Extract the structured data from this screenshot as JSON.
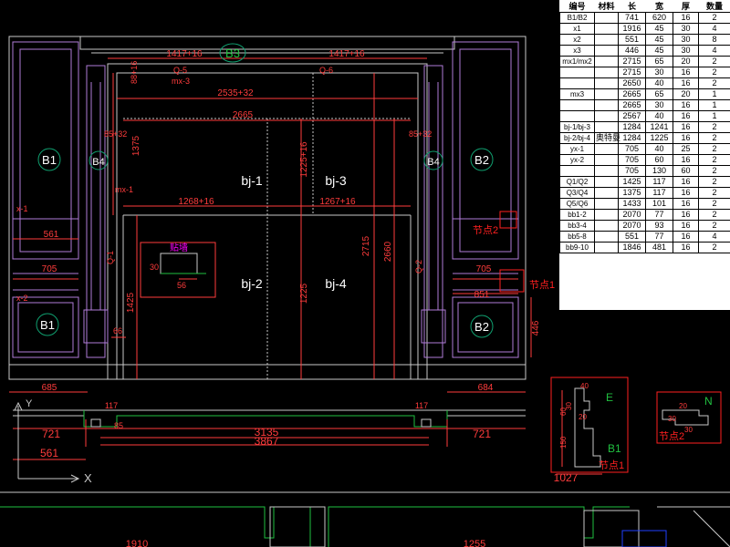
{
  "colors": {
    "background": "#000000",
    "frame": "#c9c9c9",
    "moulding": "#b07cd8",
    "dimension": "#ff3c3c",
    "section": "#20c040",
    "tag_ring": "#10a070",
    "callout": "#ff2020",
    "tag_text": "#ffffff",
    "highlight": "#ff00ff",
    "bom_bg": "#ffffff"
  },
  "elevation": {
    "tags": [
      "B1",
      "B2",
      "B3",
      "B4",
      "B4",
      "B1",
      "B2"
    ],
    "panels": [
      "bj-1",
      "bj-3",
      "bj-2",
      "bj-4"
    ],
    "dims_top": [
      "1417+16",
      "1417+16"
    ],
    "dims_inner": [
      "2535+32",
      "2665",
      "1268+16",
      "1267+16"
    ],
    "dims_vertical": [
      "1375",
      "1225+16",
      "2715",
      "2660",
      "1225",
      "1425"
    ],
    "dims_side": [
      "561",
      "705",
      "705",
      "851",
      "446"
    ],
    "dims_bottom": [
      "685",
      "684"
    ],
    "small_labels": [
      "Q-5",
      "Q-6",
      "mx-3",
      "mx-1",
      "x-1",
      "x-2",
      "Q-1",
      "Q-2",
      "85+32",
      "85+32",
      "88+16",
      "66",
      "30",
      "56"
    ],
    "callouts": [
      "节点2",
      "节点1"
    ],
    "detail_label": "贴墙"
  },
  "plan": {
    "dims_a": [
      "721",
      "3135",
      "721"
    ],
    "dims_b": [
      "3867",
      "561"
    ],
    "dims_c": [
      "117",
      "117",
      "85"
    ],
    "axis": [
      "Y",
      "X"
    ]
  },
  "details": {
    "section_e": {
      "letter": "E",
      "tag": "B1",
      "callout": "节点1",
      "width": "1027",
      "heights": [
        "40",
        "60",
        "30",
        "20",
        "150"
      ]
    },
    "section_n": {
      "letter": "N",
      "callout": "节点2",
      "dims": [
        "20",
        "30",
        "30"
      ]
    }
  },
  "bottom_strip": {
    "dims": [
      "1910",
      "1255"
    ]
  },
  "bom": {
    "headers": [
      "编号",
      "材料",
      "长",
      "宽",
      "厚",
      "数量"
    ],
    "material_note": "奥特曼",
    "rows": [
      {
        "id": "B1/B2",
        "len": "741",
        "wid": "620",
        "thk": "16",
        "qty": "2"
      },
      {
        "id": "x1",
        "len": "1916",
        "wid": "45",
        "thk": "30",
        "qty": "4"
      },
      {
        "id": "x2",
        "len": "551",
        "wid": "45",
        "thk": "30",
        "qty": "8"
      },
      {
        "id": "x3",
        "len": "446",
        "wid": "45",
        "thk": "30",
        "qty": "4"
      },
      {
        "id": "mx1/mx2",
        "len": "2715",
        "wid": "65",
        "thk": "20",
        "qty": "2"
      },
      {
        "id": "",
        "len": "2715",
        "wid": "30",
        "thk": "16",
        "qty": "2"
      },
      {
        "id": "",
        "len": "2650",
        "wid": "40",
        "thk": "16",
        "qty": "2"
      },
      {
        "id": "mx3",
        "len": "2665",
        "wid": "65",
        "thk": "20",
        "qty": "1"
      },
      {
        "id": "",
        "len": "2665",
        "wid": "30",
        "thk": "16",
        "qty": "1"
      },
      {
        "id": "",
        "len": "2567",
        "wid": "40",
        "thk": "16",
        "qty": "1"
      },
      {
        "id": "bj-1/bj-3",
        "len": "1284",
        "wid": "1241",
        "thk": "16",
        "qty": "2"
      },
      {
        "id": "bj-2/bj-4",
        "len": "1284",
        "wid": "1225",
        "thk": "16",
        "qty": "2"
      },
      {
        "id": "yx-1",
        "len": "705",
        "wid": "40",
        "thk": "25",
        "qty": "2"
      },
      {
        "id": "yx-2",
        "len": "705",
        "wid": "60",
        "thk": "16",
        "qty": "2"
      },
      {
        "id": "",
        "len": "705",
        "wid": "130",
        "thk": "60",
        "qty": "2"
      },
      {
        "id": "Q1/Q2",
        "len": "1425",
        "wid": "117",
        "thk": "16",
        "qty": "2"
      },
      {
        "id": "Q3/Q4",
        "len": "1375",
        "wid": "117",
        "thk": "16",
        "qty": "2"
      },
      {
        "id": "Q5/Q6",
        "len": "1433",
        "wid": "101",
        "thk": "16",
        "qty": "2"
      },
      {
        "id": "bb1-2",
        "len": "2070",
        "wid": "77",
        "thk": "16",
        "qty": "2"
      },
      {
        "id": "bb3-4",
        "len": "2070",
        "wid": "93",
        "thk": "16",
        "qty": "2"
      },
      {
        "id": "bb5-8",
        "len": "551",
        "wid": "77",
        "thk": "16",
        "qty": "4"
      },
      {
        "id": "bb9-10",
        "len": "1846",
        "wid": "481",
        "thk": "16",
        "qty": "2"
      }
    ]
  }
}
